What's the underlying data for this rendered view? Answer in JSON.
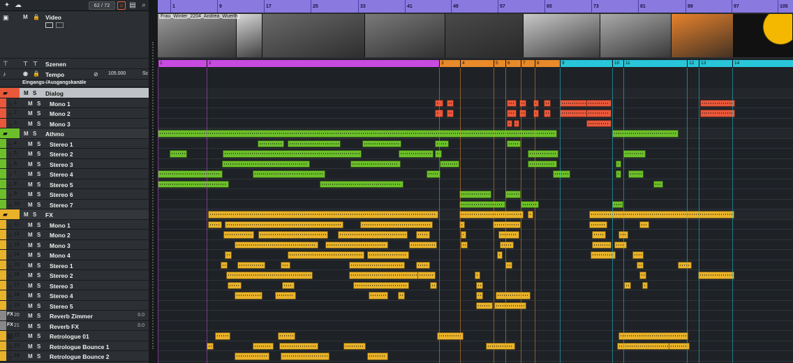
{
  "toolbar": {
    "position_counter": "62 / 72",
    "icons": [
      "tool-icon",
      "cloud-icon",
      "home-icon",
      "list-icon",
      "split-icon",
      "search-icon"
    ]
  },
  "colors": {
    "dialog": "#e8583a",
    "athmo": "#6cbf2a",
    "fx": "#e8b22a",
    "aux": "#888888",
    "ruler": "#8a7ae0",
    "scene_magenta": "#c84be0",
    "scene_orange": "#e88a2a",
    "scene_cyan": "#28c6d8"
  },
  "video": {
    "track_name": "Video",
    "clip_title": "Frau_Winter_2204_Andrea_Wuerth"
  },
  "scenes_track": {
    "name": "Szenen"
  },
  "tempo_track": {
    "name": "Tempo",
    "value": "105.000",
    "suffix": "Sc"
  },
  "io_label": "Eingangs-/Ausgangskanäle",
  "ruler_labels": [
    "1",
    "9",
    "17",
    "25",
    "33",
    "41",
    "49",
    "57",
    "65",
    "73",
    "81",
    "89",
    "97",
    "105"
  ],
  "scene_labels": [
    "1",
    "2",
    "3",
    "4",
    "5",
    "6",
    "7",
    "8",
    "9",
    "10",
    "11",
    "12",
    "13",
    "14"
  ],
  "tracks": [
    {
      "type": "folder",
      "name": "Dialog",
      "group": "dialog",
      "sel": true
    },
    {
      "type": "audio",
      "num": "1",
      "name": "Mono 1",
      "group": "dialog"
    },
    {
      "type": "audio",
      "num": "2",
      "name": "Mono 2",
      "group": "dialog"
    },
    {
      "type": "audio",
      "num": "3",
      "name": "Mono 3",
      "group": "dialog"
    },
    {
      "type": "folder",
      "name": "Athmo",
      "group": "athmo"
    },
    {
      "type": "audio",
      "num": "4",
      "name": "Stereo 1",
      "group": "athmo"
    },
    {
      "type": "audio",
      "num": "5",
      "name": "Stereo 2",
      "group": "athmo"
    },
    {
      "type": "audio",
      "num": "6",
      "name": "Stereo 3",
      "group": "athmo"
    },
    {
      "type": "audio",
      "num": "7",
      "name": "Stereo 4",
      "group": "athmo"
    },
    {
      "type": "audio",
      "num": "8",
      "name": "Stereo 5",
      "group": "athmo"
    },
    {
      "type": "audio",
      "num": "9",
      "name": "Stereo 6",
      "group": "athmo"
    },
    {
      "type": "audio",
      "num": "10",
      "name": "Stereo 7",
      "group": "athmo"
    },
    {
      "type": "folder",
      "name": "FX",
      "group": "fx"
    },
    {
      "type": "audio",
      "num": "11",
      "name": "Mono  1",
      "group": "fx"
    },
    {
      "type": "audio",
      "num": "12",
      "name": "Mono  2",
      "group": "fx"
    },
    {
      "type": "audio",
      "num": "13",
      "name": "Mono  3",
      "group": "fx"
    },
    {
      "type": "audio",
      "num": "14",
      "name": "Mono  4",
      "group": "fx"
    },
    {
      "type": "audio",
      "num": "15",
      "name": "Stereo 1",
      "group": "fx"
    },
    {
      "type": "audio",
      "num": "16",
      "name": "Stereo 2",
      "group": "fx"
    },
    {
      "type": "audio",
      "num": "17",
      "name": "Stereo 3",
      "group": "fx"
    },
    {
      "type": "audio",
      "num": "18",
      "name": "Stereo 4",
      "group": "fx"
    },
    {
      "type": "audio",
      "num": "19",
      "name": "Stereo 5",
      "group": "fx"
    },
    {
      "type": "fx",
      "num": "20",
      "name": "Reverb Zimmer",
      "group": "aux",
      "val": "0.0"
    },
    {
      "type": "fx",
      "num": "21",
      "name": "Reverb FX",
      "group": "aux",
      "val": "0.0"
    },
    {
      "type": "inst",
      "num": "22",
      "name": "Retrologue 01",
      "group": "fx"
    },
    {
      "type": "audio",
      "num": "23",
      "name": "Retrologue Bounce 1",
      "group": "fx"
    },
    {
      "type": "audio",
      "num": "24",
      "name": "Retrologue Bounce 2",
      "group": "fx"
    }
  ]
}
